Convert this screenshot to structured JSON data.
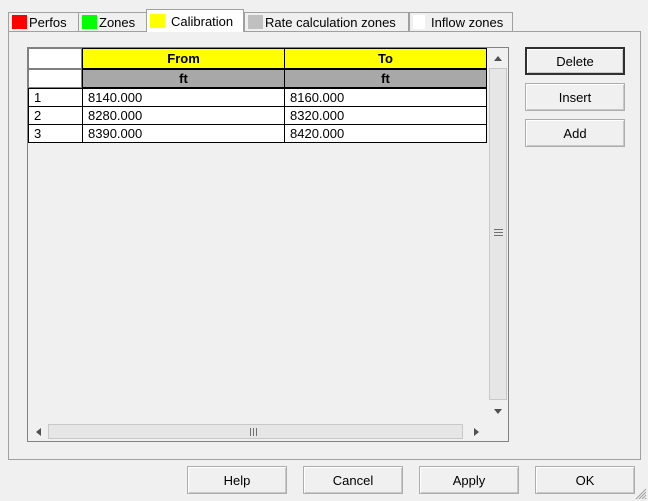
{
  "tabs": [
    {
      "label": "Perfos",
      "color": "#ff0000",
      "active": false
    },
    {
      "label": "Zones",
      "color": "#00ff00",
      "active": false
    },
    {
      "label": "Calibration",
      "color": "#ffff00",
      "active": true
    },
    {
      "label": "Rate calculation zones",
      "color": "#c0c0c0",
      "active": false
    },
    {
      "label": "Inflow zones",
      "color": "#ffffff",
      "active": false
    }
  ],
  "grid": {
    "columns": [
      {
        "header": "From",
        "unit": "ft"
      },
      {
        "header": "To",
        "unit": "ft"
      }
    ],
    "rows": [
      {
        "num": "1",
        "from": "8140.000",
        "to": "8160.000"
      },
      {
        "num": "2",
        "from": "8280.000",
        "to": "8320.000"
      },
      {
        "num": "3",
        "from": "8390.000",
        "to": "8420.000"
      }
    ]
  },
  "side_buttons": {
    "delete": "Delete",
    "insert": "Insert",
    "add": "Add"
  },
  "bottom_buttons": {
    "help": "Help",
    "cancel": "Cancel",
    "apply": "Apply",
    "ok": "OK"
  },
  "icons": {
    "scroll_up": "up-arrow-icon",
    "scroll_down": "down-arrow-icon",
    "scroll_left": "left-arrow-icon",
    "scroll_right": "right-arrow-icon",
    "resize": "resize-grip-icon"
  },
  "colors": {
    "header_yellow": "#ffff00",
    "unit_gray": "#a8a8a8"
  }
}
